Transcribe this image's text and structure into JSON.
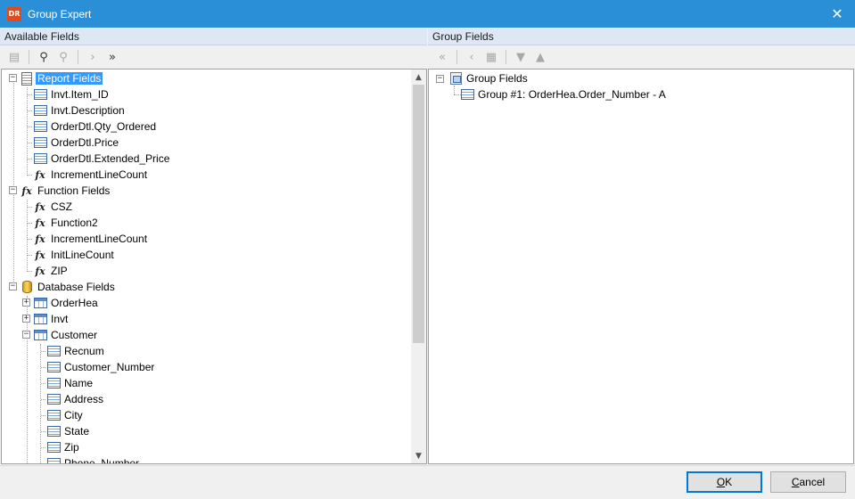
{
  "window": {
    "title": "Group Expert",
    "icon_text": "DR",
    "close_glyph": "✕"
  },
  "left_panel": {
    "header": "Available Fields",
    "toolbar": [
      {
        "name": "browse-field-icon",
        "glyph": "▤",
        "enabled": false
      },
      {
        "name": "find-icon",
        "glyph": "⚲",
        "enabled": true
      },
      {
        "name": "find-next-icon",
        "glyph": "⚲",
        "enabled": false
      },
      {
        "name": "add-selected-icon",
        "glyph": "›",
        "enabled": false
      },
      {
        "name": "add-all-icon",
        "glyph": "»",
        "enabled": true
      }
    ],
    "tree": {
      "report_fields": {
        "label": "Report Fields",
        "items": [
          "Invt.Item_ID",
          "Invt.Description",
          "OrderDtl.Qty_Ordered",
          "OrderDtl.Price",
          "OrderDtl.Extended_Price"
        ],
        "function_item": "IncrementLineCount"
      },
      "function_fields": {
        "label": "Function Fields",
        "items": [
          "CSZ",
          "Function2",
          "IncrementLineCount",
          "InitLineCount",
          "ZIP"
        ]
      },
      "database_fields": {
        "label": "Database Fields",
        "tables": [
          "OrderHea",
          "Invt",
          "Customer"
        ],
        "customer_fields": [
          "Recnum",
          "Customer_Number",
          "Name",
          "Address",
          "City",
          "State",
          "Zip",
          "Phone_Number"
        ]
      }
    }
  },
  "right_panel": {
    "header": "Group Fields",
    "toolbar": [
      {
        "name": "remove-all-icon",
        "glyph": "«",
        "enabled": false
      },
      {
        "name": "remove-selected-icon",
        "glyph": "‹",
        "enabled": false
      },
      {
        "name": "group-options-icon",
        "glyph": "▦",
        "enabled": false
      },
      {
        "name": "move-down-icon",
        "glyph": "▼",
        "enabled": false
      },
      {
        "name": "move-up-icon",
        "glyph": "▲",
        "enabled": false
      }
    ],
    "tree": {
      "root_label": "Group Fields",
      "groups": [
        "Group #1: OrderHea.Order_Number - A"
      ]
    }
  },
  "buttons": {
    "ok": {
      "underline": "O",
      "rest": "K"
    },
    "cancel": {
      "underline": "C",
      "rest": "ancel"
    }
  },
  "colors": {
    "titlebar": "#2b8fd8",
    "selection": "#3399ff",
    "header_bg": "#dde8f4"
  }
}
